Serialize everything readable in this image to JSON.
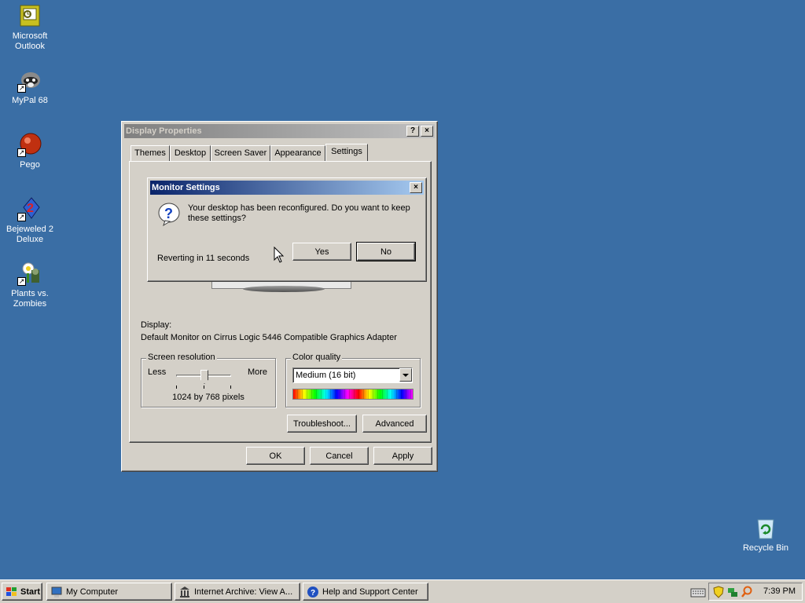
{
  "desktop": {
    "icons": [
      {
        "label": "Microsoft Outlook",
        "icon": "outlook-icon"
      },
      {
        "label": "MyPal 68",
        "icon": "mypal-icon"
      },
      {
        "label": "Pego",
        "icon": "pego-icon"
      },
      {
        "label": "Bejeweled 2 Deluxe",
        "icon": "bejeweled-icon"
      },
      {
        "label": "Plants vs. Zombies",
        "icon": "pvz-icon"
      },
      {
        "label": "Recycle Bin",
        "icon": "recycle-bin-icon"
      }
    ]
  },
  "display_properties": {
    "title": "Display Properties",
    "help_btn": "?",
    "close_btn": "×",
    "tabs": [
      "Themes",
      "Desktop",
      "Screen Saver",
      "Appearance",
      "Settings"
    ],
    "selected_tab": "Settings",
    "display_label": "Display:",
    "display_value": "Default Monitor on Cirrus Logic 5446 Compatible Graphics Adapter",
    "resolution": {
      "legend": "Screen resolution",
      "less": "Less",
      "more": "More",
      "value": "1024 by 768 pixels",
      "slider_level": 0.5
    },
    "color_quality": {
      "legend": "Color quality",
      "selected": "Medium (16 bit)"
    },
    "buttons": {
      "troubleshoot": "Troubleshoot...",
      "advanced": "Advanced",
      "ok": "OK",
      "cancel": "Cancel",
      "apply": "Apply"
    }
  },
  "monitor_settings": {
    "title": "Monitor Settings",
    "close_btn": "×",
    "message": "Your desktop has been reconfigured.  Do you want to keep these settings?",
    "countdown": "Reverting in 11 seconds",
    "yes": "Yes",
    "no": "No"
  },
  "taskbar": {
    "start": "Start",
    "tasks": [
      "My Computer",
      "Internet Archive: View A...",
      "Help and Support Center"
    ],
    "clock": "7:39 PM"
  },
  "colors": {
    "desktop": "#3a6ea5",
    "face": "#d4d0c8",
    "active_title": "#0a246a",
    "inactive_title": "#808080"
  }
}
